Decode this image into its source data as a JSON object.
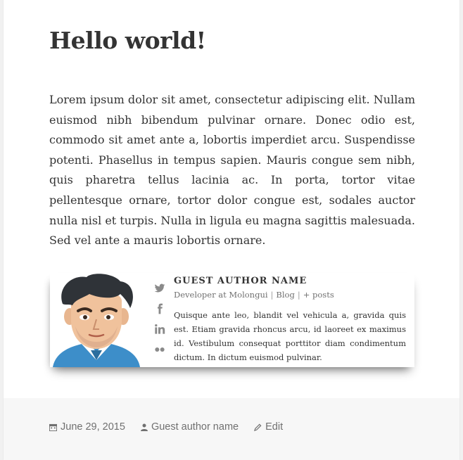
{
  "post": {
    "title": "Hello world!",
    "body": "Lorem ipsum dolor sit amet, consectetur adipiscing elit. Nullam euismod nibh bibendum pulvinar ornare. Donec odio est, commodo sit amet ante a, lobortis imperdiet arcu. Suspendisse potenti. Phasellus in tempus sapien. Mauris congue sem nibh, quis pharetra tellus lacinia ac. In porta, tortor vitae pellentesque ornare, tortor dolor congue est, sodales auctor nulla nisl et turpis. Nulla in ligula eu magna sagittis malesuada. Sed vel ante a mauris lobortis ornare."
  },
  "author_box": {
    "name": "GUEST AUTHOR NAME",
    "role": "Developer at Molongui",
    "separator": "|",
    "blog_link": "Blog",
    "posts_link": "+ posts",
    "bio": "Quisque ante leo, blandit vel vehicula a, gravida quis est. Etiam gravida rhoncus arcu, id laoreet ex maximus id. Vestibulum consequat porttitor diam condimentum dictum. In dictum euismod pulvinar.",
    "social_icons": [
      "twitter-icon",
      "facebook-icon",
      "linkedin-icon",
      "flickr-icon"
    ]
  },
  "footer": {
    "date": "June 29, 2015",
    "author": "Guest author name",
    "edit": "Edit"
  },
  "colors": {
    "text": "#333333",
    "muted": "#707070",
    "icon": "#8a8a8a",
    "footer_bg": "#f7f7f7"
  }
}
